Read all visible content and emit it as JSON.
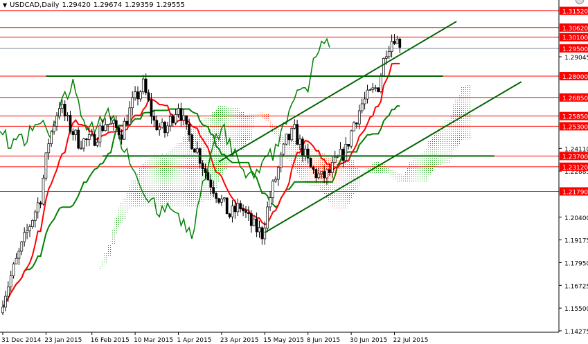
{
  "header": {
    "symbol": "USDCAD,Daily",
    "open": "1.29420",
    "high": "1.29674",
    "low": "1.29359",
    "close": "1.29555"
  },
  "colors": {
    "level": "#ff0000",
    "trend": "#006400",
    "tenkan": "#ff0000",
    "kijun": "#008000",
    "cloud_up": "#00a000",
    "cloud_down": "#ff3000"
  },
  "chart_data": {
    "type": "candlestick",
    "title": "USDCAD,Daily",
    "ylim": [
      1.14275,
      1.3205
    ],
    "price_ticks": [
      "1.29045",
      "1.24110",
      "1.22885",
      "1.20400",
      "1.19175",
      "1.17950",
      "1.16725",
      "1.15500",
      "1.14275"
    ],
    "x_ticks": [
      {
        "label": "31 Dec 2014",
        "bar": 0
      },
      {
        "label": "23 Jan 2015",
        "bar": 16
      },
      {
        "label": "16 Feb 2015",
        "bar": 33
      },
      {
        "label": "10 Mar 2015",
        "bar": 49
      },
      {
        "label": "1 Apr 2015",
        "bar": 65
      },
      {
        "label": "23 Apr 2015",
        "bar": 81
      },
      {
        "label": "15 May 2015",
        "bar": 97
      },
      {
        "label": "8 Jun 2015",
        "bar": 113
      },
      {
        "label": "30 Jun 2015",
        "bar": 129
      },
      {
        "label": "22 Jul 2015",
        "bar": 145
      }
    ],
    "close_keypoints": [
      [
        0,
        1.16
      ],
      [
        5,
        1.18
      ],
      [
        10,
        1.2
      ],
      [
        14,
        1.215
      ],
      [
        17,
        1.245
      ],
      [
        21,
        1.265
      ],
      [
        24,
        1.255
      ],
      [
        28,
        1.245
      ],
      [
        33,
        1.245
      ],
      [
        38,
        1.255
      ],
      [
        44,
        1.25
      ],
      [
        48,
        1.265
      ],
      [
        52,
        1.275
      ],
      [
        56,
        1.255
      ],
      [
        60,
        1.25
      ],
      [
        65,
        1.265
      ],
      [
        68,
        1.25
      ],
      [
        72,
        1.24
      ],
      [
        76,
        1.225
      ],
      [
        80,
        1.215
      ],
      [
        84,
        1.205
      ],
      [
        88,
        1.21
      ],
      [
        92,
        1.2
      ],
      [
        96,
        1.195
      ],
      [
        99,
        1.215
      ],
      [
        102,
        1.23
      ],
      [
        105,
        1.245
      ],
      [
        108,
        1.25
      ],
      [
        111,
        1.24
      ],
      [
        114,
        1.23
      ],
      [
        118,
        1.225
      ],
      [
        121,
        1.228
      ],
      [
        124,
        1.235
      ],
      [
        127,
        1.24
      ],
      [
        130,
        1.255
      ],
      [
        133,
        1.265
      ],
      [
        136,
        1.27
      ],
      [
        139,
        1.275
      ],
      [
        142,
        1.295
      ],
      [
        145,
        1.302
      ],
      [
        147,
        1.2955
      ]
    ],
    "levels": [
      {
        "price": 1.3152,
        "label": "1.31520"
      },
      {
        "price": 1.3062,
        "label": "1.30620"
      },
      {
        "price": 1.301,
        "label": "1.30100"
      },
      {
        "price": 1.295,
        "label": "1.29500",
        "gray": true
      },
      {
        "price": 1.28,
        "label": "1.28000"
      },
      {
        "price": 1.2685,
        "label": "1.26850"
      },
      {
        "price": 1.2585,
        "label": "1.25850"
      },
      {
        "price": 1.253,
        "label": "1.25300"
      },
      {
        "price": 1.237,
        "label": "1.23700"
      },
      {
        "price": 1.2312,
        "label": "1.23120"
      },
      {
        "price": 1.2179,
        "label": "1.21790"
      }
    ],
    "green_lines": [
      {
        "from_bar": 16,
        "to_bar": 163,
        "from_price": 1.28,
        "to_price": 1.28
      },
      {
        "from_bar": 37,
        "to_bar": 182,
        "from_price": 1.237,
        "to_price": 1.237
      },
      {
        "from_bar": 80,
        "to_bar": 168,
        "from_price": 1.2339,
        "to_price": 1.3095
      },
      {
        "from_bar": 97,
        "to_bar": 192,
        "from_price": 1.1957,
        "to_price": 1.277
      }
    ]
  }
}
